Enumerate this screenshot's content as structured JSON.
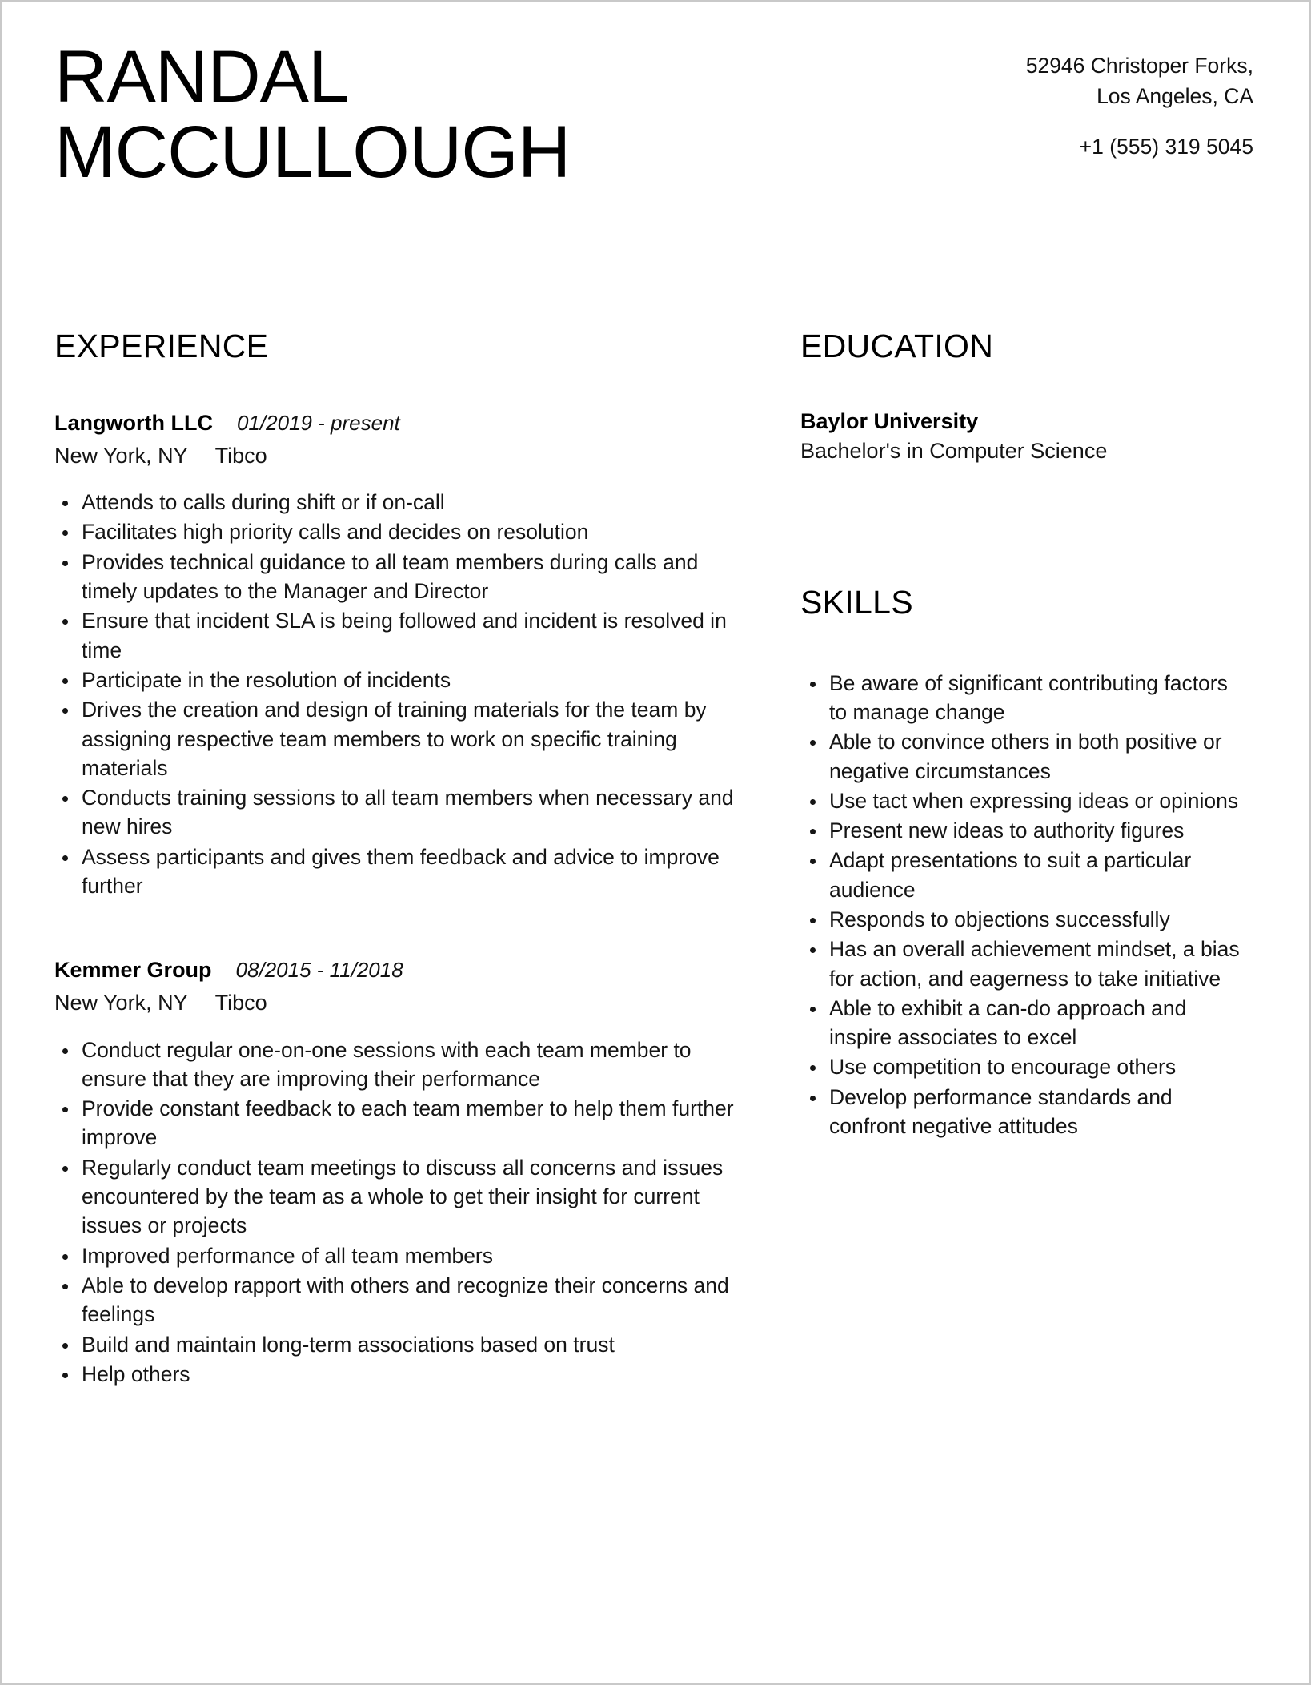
{
  "header": {
    "name_lines": [
      "RANDAL",
      "MCCULLOUGH"
    ],
    "contact": {
      "address_line1": "52946 Christoper Forks,",
      "address_line2": "Los Angeles, CA",
      "phone": "+1 (555) 319 5045"
    }
  },
  "sections": {
    "experience": {
      "title": "EXPERIENCE",
      "entries": [
        {
          "organization": "Langworth LLC",
          "dates": "01/2019 - present",
          "location": "New York, NY",
          "client": "Tibco",
          "bullets": [
            "Attends to calls during shift or if on-call",
            "Facilitates high priority calls and decides on resolution",
            "Provides technical guidance to all team members during calls and timely updates to the Manager and Director",
            "Ensure that incident SLA is being followed and incident is resolved in time",
            "Participate in the resolution of incidents",
            "Drives the creation and design of training materials for the team by assigning respective team members to work on specific training materials",
            "Conducts training sessions to all team members when necessary and new hires",
            "Assess participants and gives them feedback and advice to improve further"
          ]
        },
        {
          "organization": "Kemmer Group",
          "dates": "08/2015 - 11/2018",
          "location": "New York, NY",
          "client": "Tibco",
          "bullets": [
            "Conduct regular one-on-one sessions with each team member to ensure that they are improving their performance",
            "Provide constant feedback to each team member to help them further improve",
            "Regularly conduct team meetings to discuss all concerns and issues encountered by the team as a whole to get their insight for current issues or projects",
            "Improved performance of all team members",
            "Able to develop rapport with others and recognize their concerns and feelings",
            "Build and maintain long-term associations based on trust",
            "Help others"
          ]
        }
      ]
    },
    "education": {
      "title": "EDUCATION",
      "entries": [
        {
          "institution": "Baylor University",
          "degree": "Bachelor's in Computer Science"
        }
      ]
    },
    "skills": {
      "title": "SKILLS",
      "items": [
        "Be aware of significant contributing factors to manage change",
        "Able to convince others in both positive or negative circumstances",
        "Use tact when expressing ideas or opinions",
        "Present new ideas to authority figures",
        "Adapt presentations to suit a particular audience",
        "Responds to objections successfully",
        "Has an overall achievement mindset, a bias for action, and eagerness to take initiative",
        "Able to exhibit a can-do approach and inspire associates to excel",
        "Use competition to encourage others",
        "Develop performance standards and confront negative attitudes"
      ]
    }
  }
}
